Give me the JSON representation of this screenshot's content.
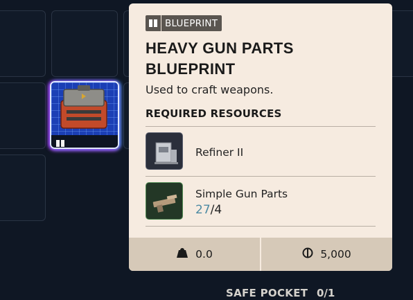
{
  "tooltip": {
    "tag_label": "BLUEPRINT",
    "title": "HEAVY GUN PARTS BLUEPRINT",
    "description": "Used to craft weapons.",
    "required_title": "REQUIRED RESOURCES",
    "resources": [
      {
        "name": "Refiner II",
        "icon": "refiner-machine-icon"
      },
      {
        "name": "Simple Gun Parts",
        "have": "27",
        "separator": "/",
        "need": "4",
        "icon": "gun-parts-icon"
      }
    ],
    "weight": "0.0",
    "price": "5,000"
  },
  "inventory": {
    "safe_pocket_label": "SAFE POCKET",
    "safe_pocket_count": "0/1"
  },
  "colors": {
    "panel_bg": "#f6ebe0",
    "footer_bg": "#d6c9b8",
    "count_have": "#4c8aa3",
    "slot_highlight": "#a040ff"
  }
}
